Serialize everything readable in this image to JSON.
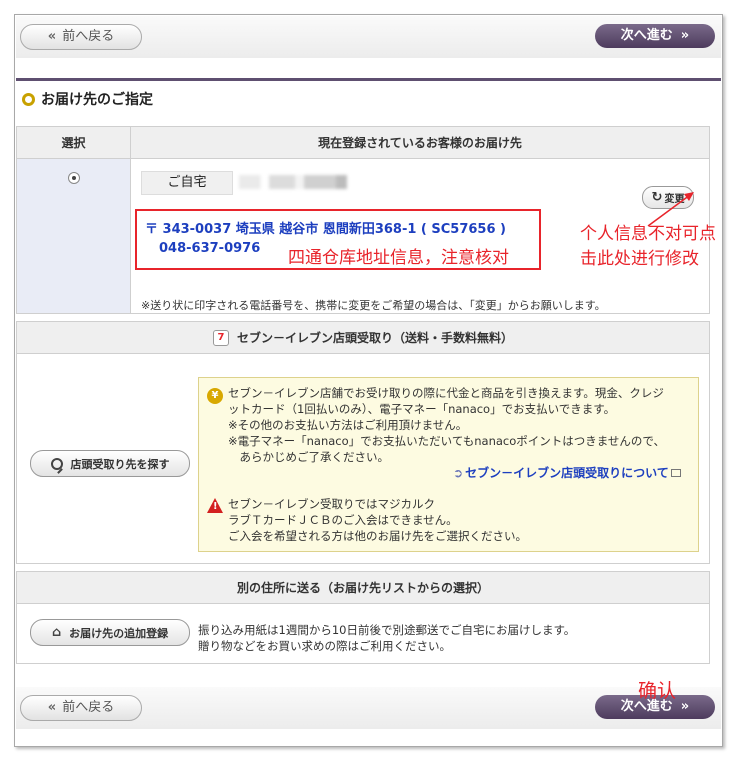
{
  "nav": {
    "back_label": "前へ戻る",
    "back_chevron": "«",
    "next_label": "次へ進む",
    "next_chevron": "»"
  },
  "section": {
    "title": "お届け先のご指定"
  },
  "registered": {
    "col_select": "選択",
    "col_address": "現在登録されているお客様のお届け先",
    "home_label": "ご自宅",
    "change_label": "変更",
    "addr_line1": "〒 343-0037  埼玉県  越谷市 恩間新田368-1 ( SC57656 )",
    "addr_line2": "048-637-0976",
    "phone_note": "※送り状に印字される電話番号を、携帯に変更をご希望の場合は、「変更」からお願いします。"
  },
  "seven": {
    "title": "セブン－イレブン店頭受取り（送料・手数料無料）",
    "icon_text": "7",
    "search_button": "店頭受取り先を探す",
    "pay_lines": [
      "セブン－イレブン店舗でお受け取りの際に代金と商品を引き換えます。現金、クレジ",
      "ットカード（1回払いのみ）、電子マネー「nanaco」でお支払いできます。",
      "※その他のお支払い方法はご利用頂けません。",
      "※電子マネー「nanaco」でお支払いただいてもnanacoポイントはつきませんので、",
      "　あらかじめご了承ください。"
    ],
    "link_text": "セブン－イレブン店頭受取りについて",
    "warn_lines": [
      "セブン－イレブン受取りではマジカルク",
      "ラブＴカードＪＣＢのご入会はできません。",
      "ご入会を希望される方は他のお届け先をご選択ください。"
    ]
  },
  "other": {
    "title": "別の住所に送る（お届け先リストからの選択）",
    "add_button": "お届け先の追加登録",
    "lines": [
      "振り込み用紙は1週間から10日前後で別途郵送でご自宅にお届けします。",
      "贈り物などをお買い求めの際はご利用ください。"
    ]
  },
  "annotations": {
    "address_note": "四通仓库地址信息，注意核对",
    "change_note_line1": "个人信息不对可点",
    "change_note_line2": "击此处进行修改",
    "confirm_note": "确认",
    "color": "#e8242b"
  },
  "colors": {
    "accent_purple": "#5e4f70",
    "link_blue": "#1d3fbf",
    "annotation_red": "#e8242b"
  }
}
